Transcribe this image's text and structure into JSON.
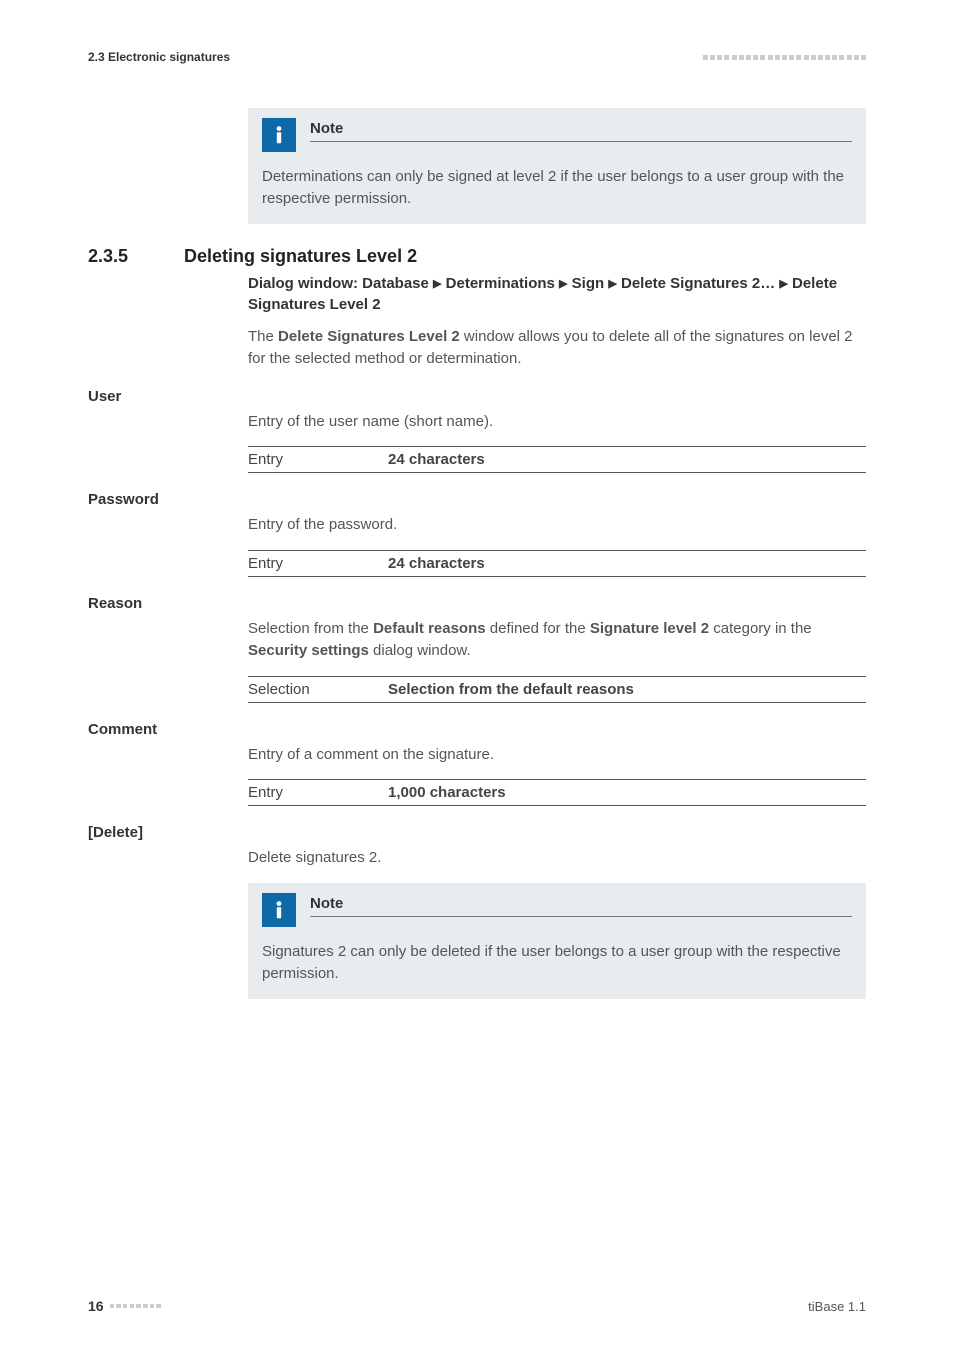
{
  "header": {
    "section_ref": "2.3 Electronic signatures"
  },
  "note1": {
    "title": "Note",
    "body": "Determinations can only be signed at level 2 if the user belongs to a user group with the respective permission."
  },
  "section": {
    "number": "2.3.5",
    "title": "Deleting signatures Level 2",
    "dialog_prefix": "Dialog window: Database ",
    "dialog_p2": " Determinations ",
    "dialog_p3": " Sign ",
    "dialog_p4": " Delete Signatures 2… ",
    "dialog_p5": " Delete Signatures Level 2",
    "intro_a": "The ",
    "intro_b": "Delete Signatures Level 2",
    "intro_c": " window allows you to delete all of the signatures on level 2 for the selected method or determination."
  },
  "fields": {
    "user": {
      "label": "User",
      "desc": "Entry of the user name (short name).",
      "entry_label": "Entry",
      "entry_value": "24 characters"
    },
    "password": {
      "label": "Password",
      "desc": "Entry of the password.",
      "entry_label": "Entry",
      "entry_value": "24 characters"
    },
    "reason": {
      "label": "Reason",
      "desc_a": "Selection from the ",
      "desc_b": "Default reasons",
      "desc_c": " defined for the ",
      "desc_d": "Signature level 2",
      "desc_e": " category in the ",
      "desc_f": "Security settings",
      "desc_g": " dialog window.",
      "entry_label": "Selection",
      "entry_value": "Selection from the default reasons"
    },
    "comment": {
      "label": "Comment",
      "desc": "Entry of a comment on the signature.",
      "entry_label": "Entry",
      "entry_value": "1,000 characters"
    },
    "delete": {
      "label": "[Delete]",
      "desc": "Delete signatures 2."
    }
  },
  "note2": {
    "title": "Note",
    "body": "Signatures 2 can only be deleted if the user belongs to a user group with the respective permission."
  },
  "footer": {
    "page": "16",
    "product": "tiBase 1.1"
  }
}
